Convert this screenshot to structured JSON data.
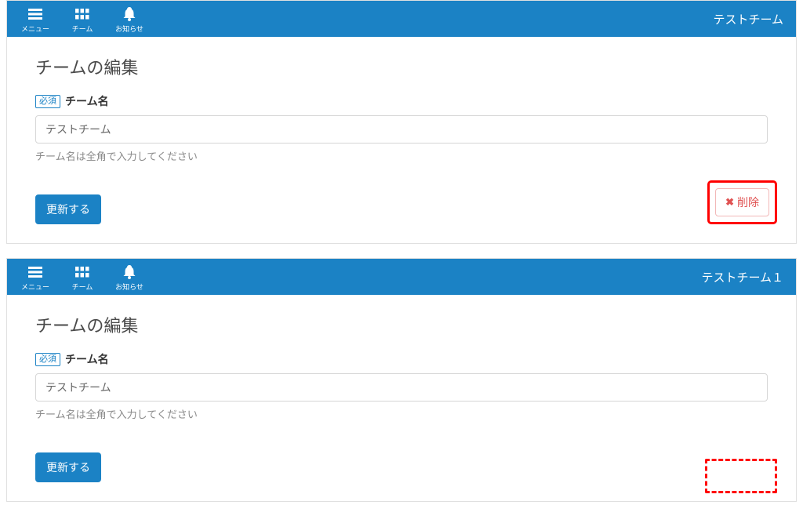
{
  "nav": {
    "menu_label": "メニュー",
    "team_label": "チーム",
    "notice_label": "お知らせ"
  },
  "panel1": {
    "team_display": "テストチーム",
    "title": "チームの編集",
    "required_badge": "必須",
    "field_label": "チーム名",
    "field_value": "テストチーム",
    "help_text": "チーム名は全角で入力してください",
    "update_label": "更新する",
    "delete_label": "削除"
  },
  "panel2": {
    "team_display": "テストチーム１",
    "title": "チームの編集",
    "required_badge": "必須",
    "field_label": "チーム名",
    "field_value": "テストチーム",
    "help_text": "チーム名は全角で入力してください",
    "update_label": "更新する"
  }
}
